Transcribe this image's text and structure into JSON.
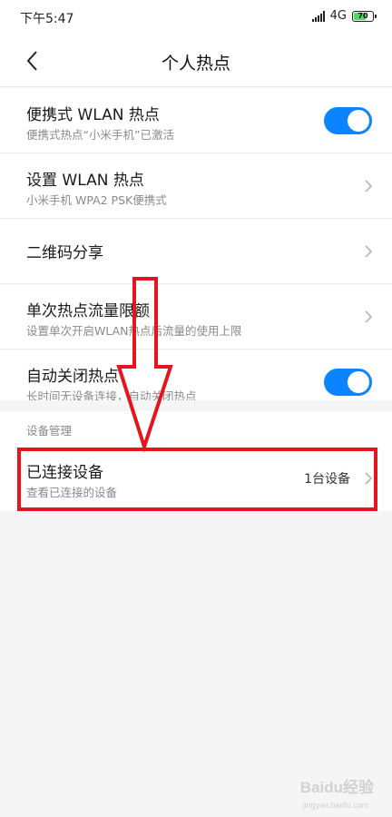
{
  "status": {
    "time": "下午5:47",
    "network": "4G",
    "battery": "70",
    "battery_level": 0.7
  },
  "header": {
    "title": "个人热点"
  },
  "settings": [
    {
      "title": "便携式 WLAN 热点",
      "subtitle": "便携式热点“小米手机”已激活",
      "control": "toggle",
      "on": true
    },
    {
      "title": "设置 WLAN 热点",
      "subtitle": "小米手机 WPA2 PSK便携式",
      "control": "chevron"
    },
    {
      "title": "二维码分享",
      "subtitle": "",
      "control": "chevron"
    },
    {
      "title": "单次热点流量限额",
      "subtitle": "设置单次开启WLAN热点后流量的使用上限",
      "control": "chevron"
    },
    {
      "title": "自动关闭热点",
      "subtitle": "长时间无设备连接，自动关闭热点",
      "control": "toggle",
      "on": true
    }
  ],
  "device_section": {
    "label": "设备管理",
    "item": {
      "title": "已连接设备",
      "subtitle": "查看已连接的设备",
      "value": "1台设备"
    }
  },
  "colors": {
    "accent": "#0d84ff",
    "annotation": "#e5151f"
  },
  "watermark": {
    "brand": "Baidu经验",
    "url": "jingyan.baidu.com"
  }
}
